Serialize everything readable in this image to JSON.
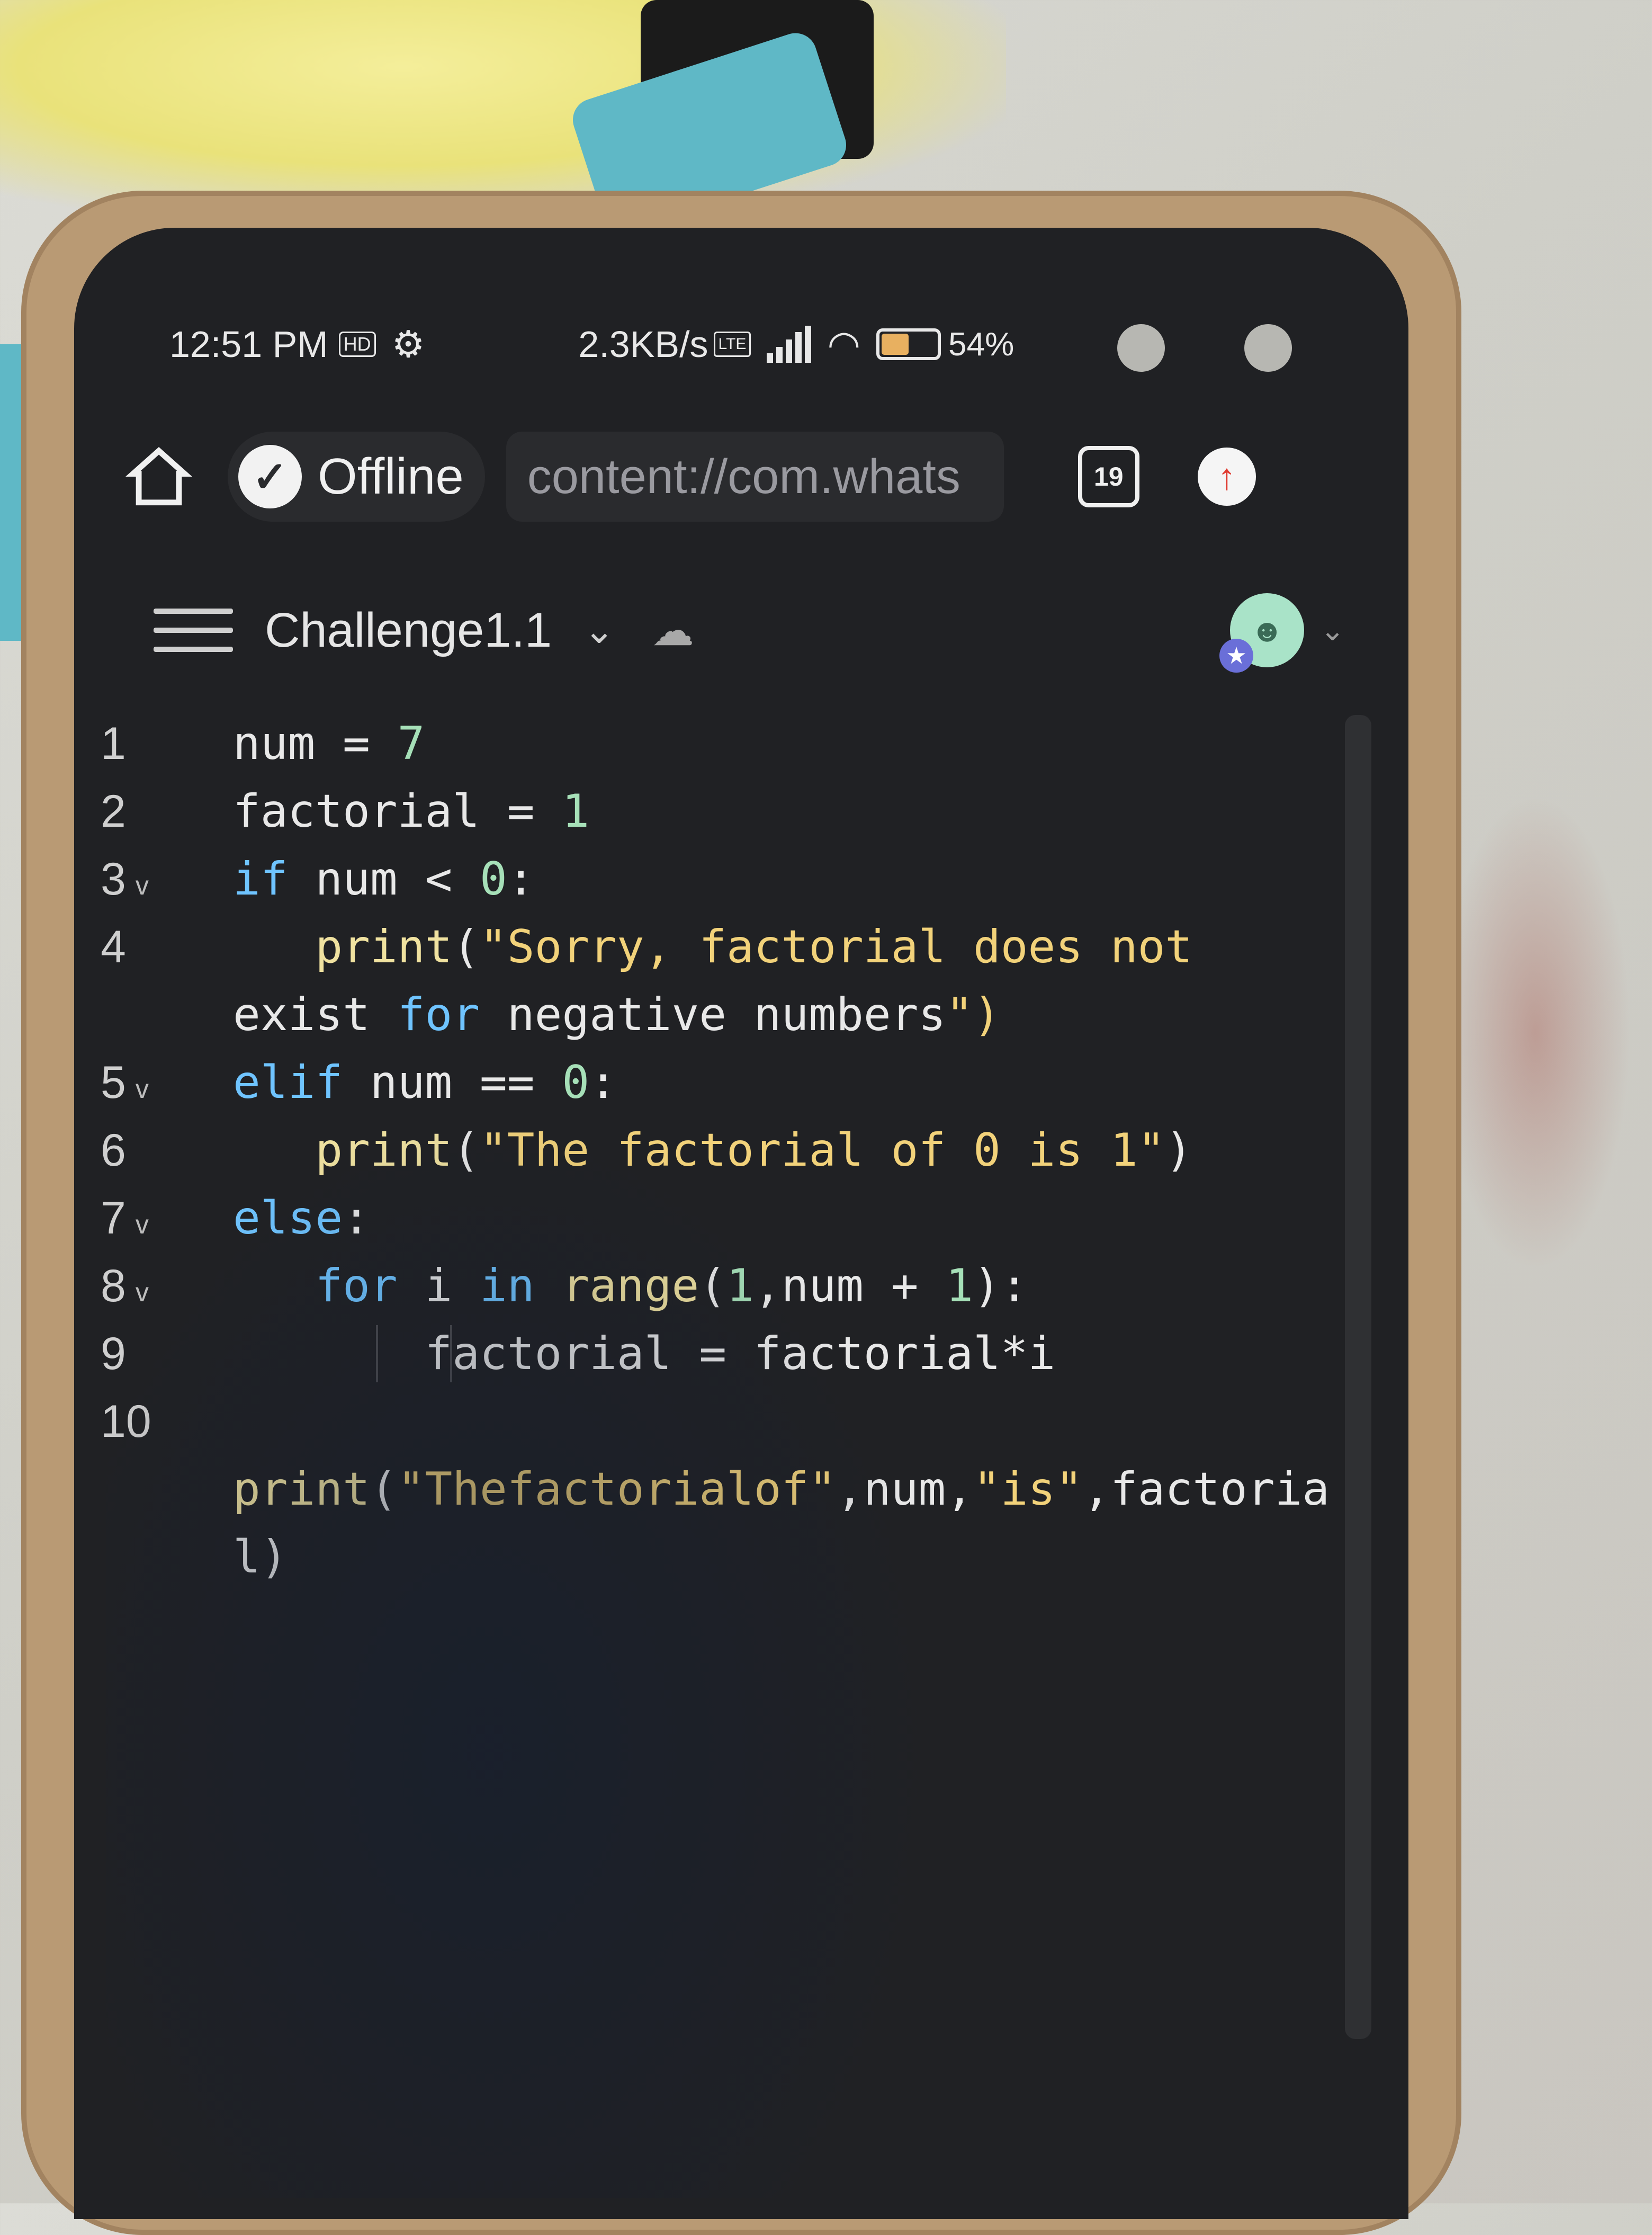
{
  "status_bar": {
    "time": "12:51 PM",
    "hd_badge": "HD",
    "network_speed": "2.3KB/s",
    "lte_badge": "LTE",
    "network_type": "4G",
    "battery": "54%",
    "battery_level": 0.54,
    "gear_icon": "gear-icon",
    "wifi_icon": "wifi-icon"
  },
  "browser": {
    "home_icon": "home-icon",
    "status_label": "Offline",
    "url": "content://com.whats",
    "tab_count": "19",
    "update_icon": "arrow-up-icon"
  },
  "file": {
    "name": "Challenge1.1",
    "dropdown_icon": "chevron-down-icon",
    "synced_icon": "cloud-check-icon",
    "avatar_icon": "avatar-icon"
  },
  "code": {
    "lines": [
      {
        "number": "1",
        "fold": "",
        "text": "num = 7"
      },
      {
        "number": "2",
        "fold": "",
        "text": "factorial = 1"
      },
      {
        "number": "3",
        "fold": "v",
        "text": "if num < 0:"
      },
      {
        "number": "4",
        "fold": "",
        "text": "   print(\"Sorry, factorial does not"
      },
      {
        "number": "",
        "fold": "",
        "text": "exist for negative numbers\")"
      },
      {
        "number": "5",
        "fold": "v",
        "text": "elif num == 0:"
      },
      {
        "number": "6",
        "fold": "",
        "text": "   print(\"The factorial of 0 is 1\")"
      },
      {
        "number": "7",
        "fold": "v",
        "text": "else:"
      },
      {
        "number": "8",
        "fold": "v",
        "text": "   for i in range(1,num + 1):"
      },
      {
        "number": "9",
        "fold": "",
        "text": "       factorial = factorial*i"
      },
      {
        "number": "10",
        "fold": "",
        "text": ""
      },
      {
        "number": "",
        "fold": "",
        "text": "print(\"Thefactorialof\",num,\"is\",factoria"
      },
      {
        "number": "",
        "fold": "",
        "text": "l)"
      }
    ]
  },
  "colors": {
    "editor_bg": "#202124",
    "keyword": "#6fc4ff",
    "string": "#f2d27a",
    "number": "#a6e0b8"
  }
}
